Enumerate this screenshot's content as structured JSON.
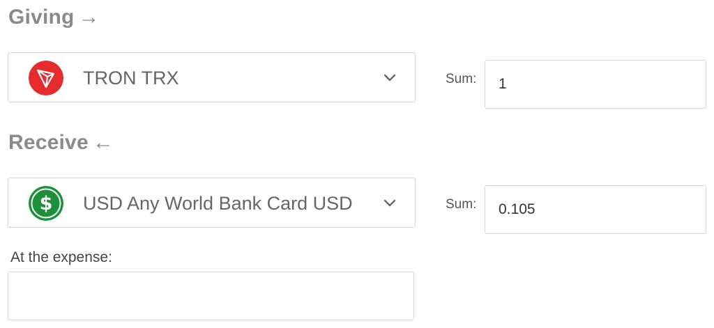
{
  "giving": {
    "heading": "Giving",
    "arrow": "→",
    "currency_label": "TRON TRX",
    "currency_icon": "tron-icon",
    "icon_color": "#e52b2b",
    "sum_label": "Sum:",
    "sum_value": "1"
  },
  "receive": {
    "heading": "Receive",
    "arrow": "←",
    "currency_label": "USD Any World Bank Card USD",
    "currency_icon": "dollar-icon",
    "icon_color": "#1e8f3a",
    "sum_label": "Sum:",
    "sum_value": "0.105"
  },
  "expense": {
    "label": "At the expense:",
    "value": ""
  }
}
